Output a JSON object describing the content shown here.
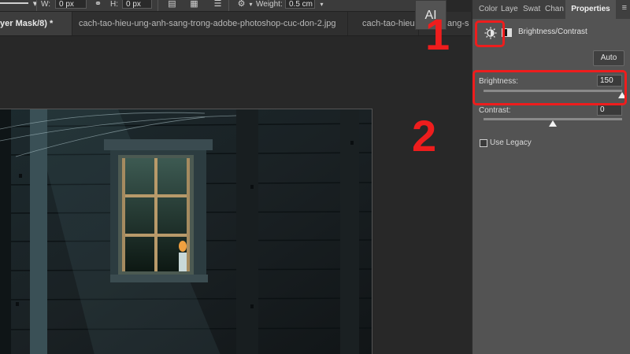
{
  "options_bar": {
    "w_label": "W:",
    "w_value": "0 px",
    "h_label": "H:",
    "h_value": "0 px",
    "weight_label": "Weight:",
    "weight_value": "0.5 cm",
    "icons": [
      "align-icon",
      "path-arrange-icon",
      "stack-icon",
      "gear-icon"
    ]
  },
  "tabs": [
    {
      "label": "yer Mask/8) *",
      "active": true
    },
    {
      "label": "cach-tao-hieu-ung-anh-sang-trong-adobe-photoshop-cuc-don-2.jpg",
      "active": false
    },
    {
      "label": "cach-tao-hieu-",
      "active": false
    },
    {
      "label": "ang-s",
      "active": false
    }
  ],
  "ai_button": "AI",
  "annotations": {
    "step1": "1",
    "step2": "2"
  },
  "panel": {
    "tabs": [
      "Color",
      "Layer",
      "Swat",
      "Chan",
      "Properties"
    ],
    "active_tab": "Properties",
    "menu_icon": "≡",
    "adjustment_title": "Brightness/Contrast",
    "auto_label": "Auto",
    "brightness_label": "Brightness:",
    "brightness_value": "150",
    "brightness_fraction": 1.0,
    "contrast_label": "Contrast:",
    "contrast_value": "0",
    "contrast_fraction": 0.5,
    "legacy_label": "Use Legacy",
    "legacy_checked": false
  },
  "colors": {
    "annotation_red": "#ee1d1d",
    "panel_bg": "#535353",
    "canvas_bg": "#282828"
  }
}
